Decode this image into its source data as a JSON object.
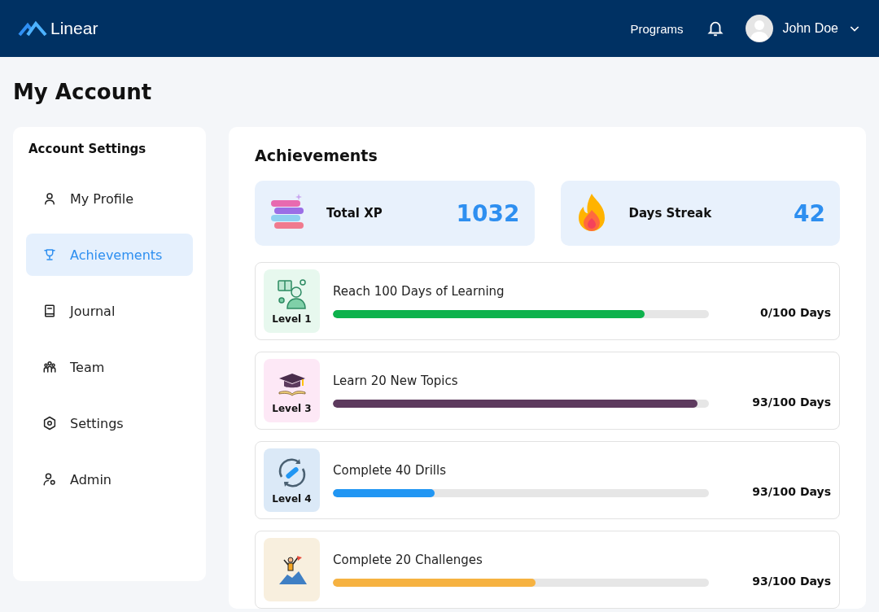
{
  "header": {
    "logo": "Linear",
    "nav": [
      "Programs"
    ],
    "user": {
      "name": "John Doe"
    }
  },
  "page_title": "My Account",
  "sidebar": {
    "title": "Account Settings",
    "items": [
      {
        "label": "My Profile",
        "kind": "profile",
        "selected": false
      },
      {
        "label": "Achievements",
        "kind": "trophy",
        "selected": true
      },
      {
        "label": "Journal",
        "kind": "journal",
        "selected": false
      },
      {
        "label": "Team",
        "kind": "team",
        "selected": false
      },
      {
        "label": "Settings",
        "kind": "settings",
        "selected": false
      },
      {
        "label": "Admin",
        "kind": "admin",
        "selected": false
      }
    ]
  },
  "achievements": {
    "title": "Achievements",
    "stats": [
      {
        "label": "Total XP",
        "value": "1032",
        "kind": "xp"
      },
      {
        "label": "Days Streak",
        "value": "42",
        "kind": "streak"
      }
    ],
    "items": [
      {
        "title": "Reach 100 Days of Learning",
        "level": 0.83,
        "color": "#0db24c",
        "badge": "Level 1",
        "kind": "learning",
        "reading": "0/100 Days"
      },
      {
        "title": "Learn 20 New Topics",
        "level": 0.97,
        "color": "#5d3a5e",
        "badge": "Level 3",
        "kind": "graduation",
        "reading": "93/100 Days"
      },
      {
        "title": "Complete 40 Drills",
        "level": 0.27,
        "color": "#2196f3",
        "badge": "Level 4",
        "kind": "drills",
        "reading": "93/100 Days"
      },
      {
        "title": "Complete 20 Challenges",
        "level": 0.54,
        "color": "#f6b241",
        "kind": "challenge",
        "reading": "93/100 Days"
      }
    ]
  }
}
